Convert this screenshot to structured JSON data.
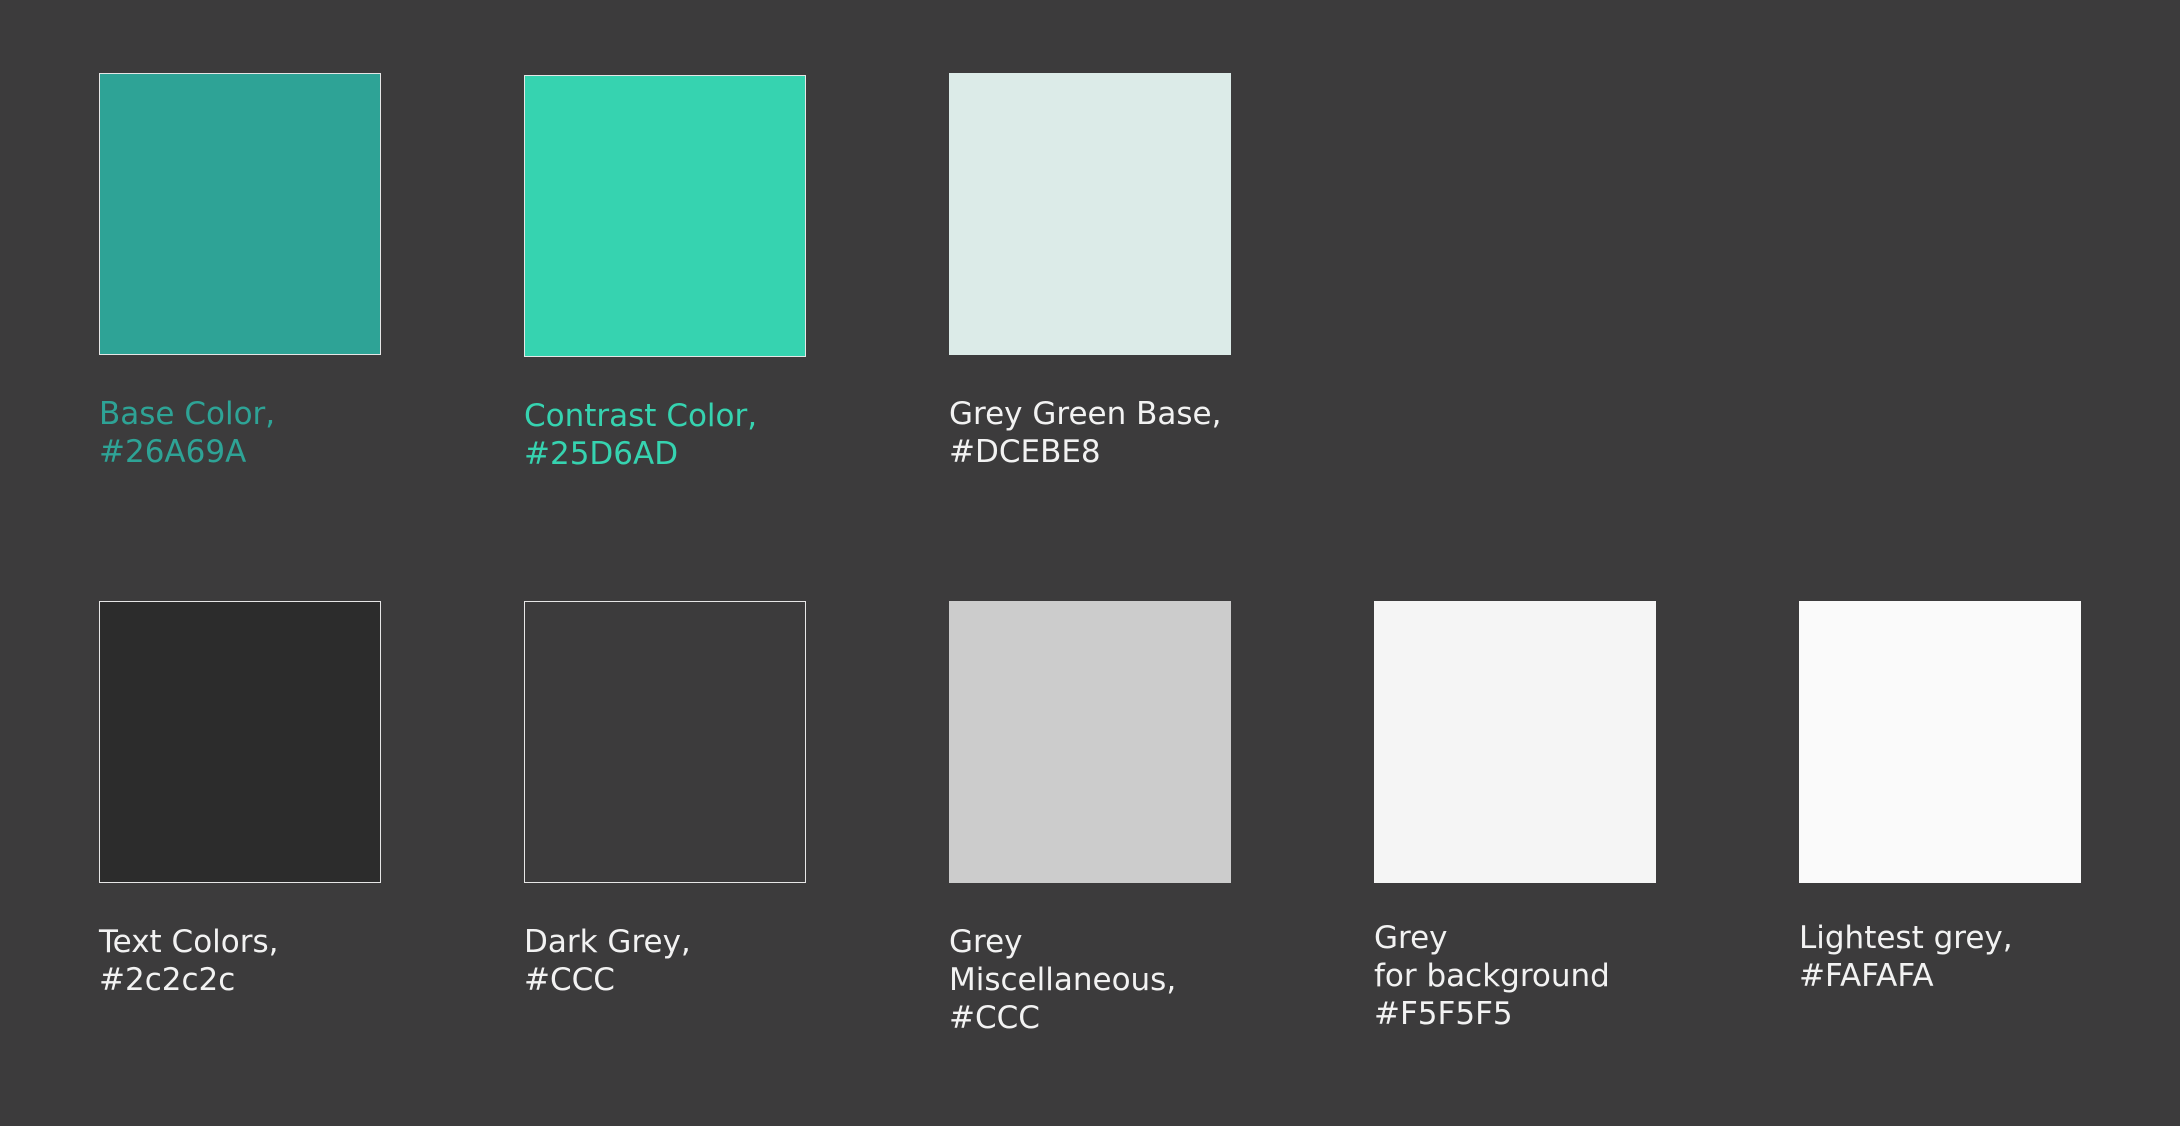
{
  "row1": [
    {
      "name_line": "Base Color,",
      "code_line": "#26A69A",
      "swatch_color": "#2ea396",
      "label_color": "#2ea396",
      "bordered": true
    },
    {
      "name_line": "Contrast Color,",
      "code_line": "#25D6AD",
      "swatch_color": "#36d3b0",
      "label_color": "#36d3b0",
      "bordered": true
    },
    {
      "name_line": "Grey Green Base,",
      "code_line": "#DCEBE8",
      "swatch_color": "#dcebe8",
      "label_color": "#f2f2f2",
      "bordered": false
    }
  ],
  "row2": [
    {
      "lines": [
        "Text Colors,",
        "#2c2c2c"
      ],
      "swatch_color": "#2c2c2c",
      "bordered": true
    },
    {
      "lines": [
        "Dark Grey,",
        "#CCC"
      ],
      "swatch_color": "#3c3b3c",
      "bordered": true
    },
    {
      "lines": [
        "Grey",
        "Miscellaneous,",
        "#CCC"
      ],
      "swatch_color": "#cccccc",
      "bordered": false
    },
    {
      "lines": [
        "Grey",
        "for background",
        "#F5F5F5"
      ],
      "swatch_color": "#f5f5f5",
      "bordered": false
    },
    {
      "lines": [
        "Lightest grey,",
        "#FAFAFA"
      ],
      "swatch_color": "#fafafa",
      "bordered": false
    }
  ]
}
